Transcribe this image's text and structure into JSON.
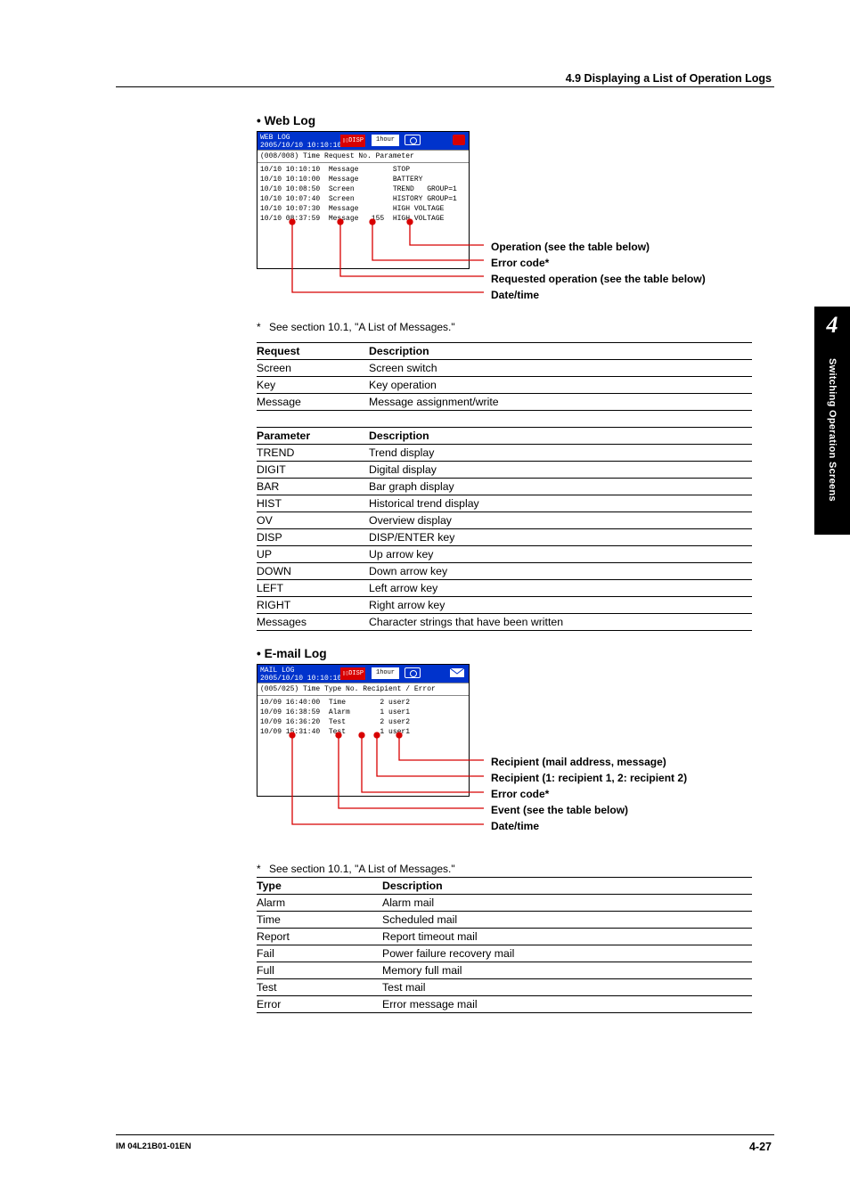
{
  "header": {
    "section": "4.9  Displaying a List of Operation Logs"
  },
  "sidetab": {
    "chapter": "4",
    "title": "Switching Operation Screens"
  },
  "footer": {
    "left": "IM 04L21B01-01EN",
    "right": "4-27"
  },
  "weblog": {
    "heading": "Web Log",
    "title1": "WEB LOG",
    "title2": "2005/10/10 10:10:10",
    "disp": "DISP",
    "hour": "1hour",
    "colhdr": "(008/008) Time  Request   No.  Parameter",
    "rows": [
      "10/10 10:10:10  Message        STOP",
      "10/10 10:10:00  Message        BATTERY",
      "10/10 10:08:50  Screen         TREND   GROUP=1",
      "10/10 10:07:40  Screen         HISTORY GROUP=1",
      "10/10 10:07:30  Message        HIGH VOLTAGE",
      "10/10 08:37:59  Message   155  HIGH VOLTAGE"
    ],
    "callouts": {
      "a": "Operation (see the table below)",
      "b": "Error code*",
      "c": "Requested operation (see the table below)",
      "d": "Date/time"
    },
    "footnote": "See section 10.1, \"A List of Messages.\"",
    "table1": {
      "h1": "Request",
      "h2": "Description",
      "rows": [
        [
          "Screen",
          "Screen switch"
        ],
        [
          "Key",
          "Key operation"
        ],
        [
          "Message",
          "Message assignment/write"
        ]
      ]
    },
    "table2": {
      "h1": "Parameter",
      "h2": "Description",
      "rows": [
        [
          "TREND",
          "Trend display"
        ],
        [
          "DIGIT",
          "Digital display"
        ],
        [
          "BAR",
          "Bar graph display"
        ],
        [
          "HIST",
          "Historical trend display"
        ],
        [
          "OV",
          "Overview display"
        ],
        [
          "DISP",
          "DISP/ENTER key"
        ],
        [
          "UP",
          "Up arrow key"
        ],
        [
          "DOWN",
          "Down arrow key"
        ],
        [
          "LEFT",
          "Left arrow key"
        ],
        [
          "RIGHT",
          "Right arrow key"
        ],
        [
          "Messages",
          "Character strings that have been written"
        ]
      ]
    }
  },
  "emaillog": {
    "heading": "E-mail Log",
    "title1": "MAIL LOG",
    "title2": "2005/10/10 10:10:10",
    "disp": "DISP",
    "hour": "1hour",
    "colhdr": "(005/025) Time  Type    No. Recipient / Error",
    "rows": [
      "10/09 16:40:00  Time        2 user2",
      "10/09 16:38:59  Alarm       1 user1",
      "10/09 16:36:20  Test        2 user2",
      "10/09 15:31:40  Test        1 user1"
    ],
    "callouts": {
      "a": "Recipient (mail address, message)",
      "b": "Recipient (1: recipient 1, 2: recipient 2)",
      "c": "Error code*",
      "d": "Event (see the table below)",
      "e": "Date/time"
    },
    "footnote": "See section 10.1, \"A List of Messages.\"",
    "table": {
      "h1": "Type",
      "h2": "Description",
      "rows": [
        [
          "Alarm",
          "Alarm mail"
        ],
        [
          "Time",
          "Scheduled mail"
        ],
        [
          "Report",
          "Report timeout mail"
        ],
        [
          "Fail",
          "Power failure recovery mail"
        ],
        [
          "Full",
          "Memory full mail"
        ],
        [
          "Test",
          "Test mail"
        ],
        [
          "Error",
          "Error message mail"
        ]
      ]
    }
  }
}
